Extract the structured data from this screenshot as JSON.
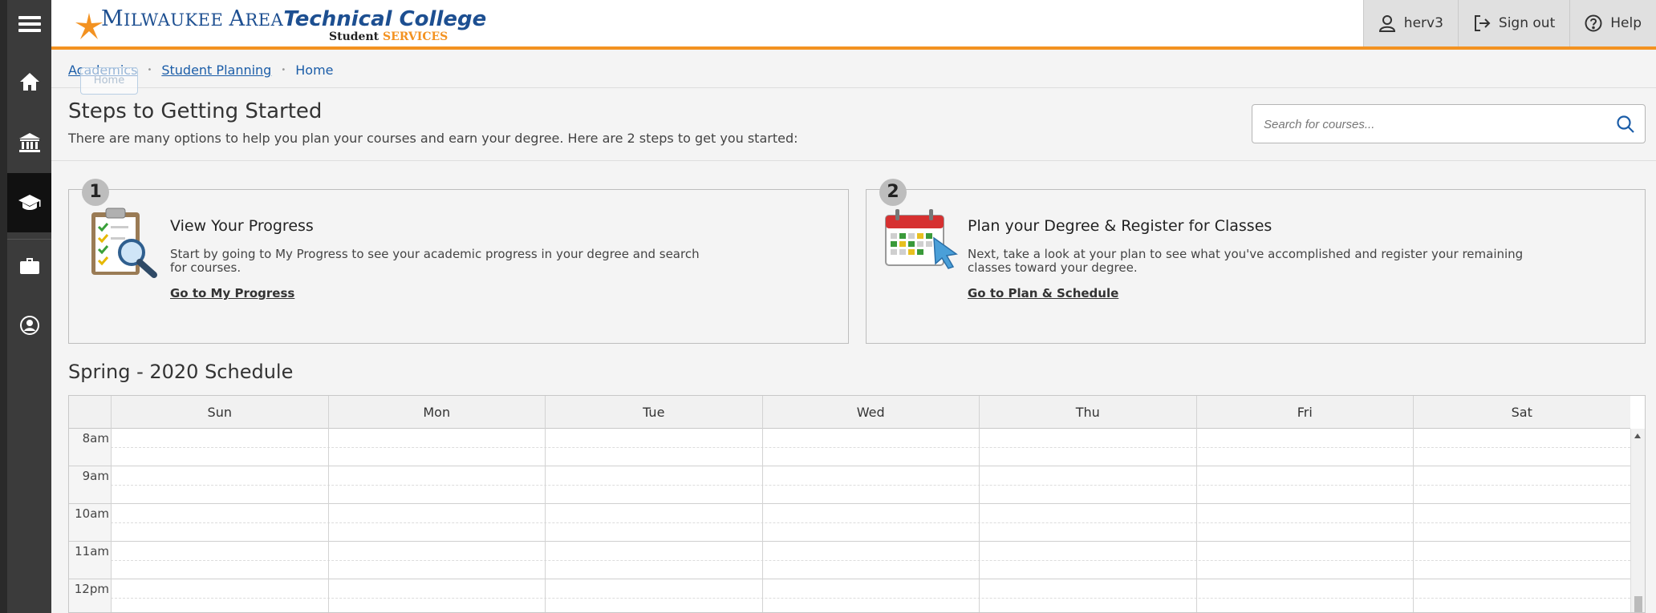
{
  "header": {
    "logo_name_prefix": "M",
    "logo_name_mid": "ILWAUKEE ",
    "logo_area_prefix": "A",
    "logo_area_mid": "REA",
    "logo_tech": "Technical College",
    "logo_sub_1": "Student ",
    "logo_sub_2": "SERVICES",
    "user": "herv3",
    "sign_out": "Sign out",
    "help": "Help"
  },
  "rail": {
    "items": [
      "menu",
      "home",
      "academics",
      "student-planning",
      "financial",
      "profile"
    ],
    "active": "student-planning"
  },
  "breadcrumb": {
    "items": [
      "Academics",
      "Student Planning"
    ],
    "current": "Home",
    "tooltip": "Home"
  },
  "getting_started": {
    "title": "Steps to Getting Started",
    "description": "There are many options to help you plan your courses and earn your degree. Here are 2 steps to get you started:",
    "search_placeholder": "Search for courses..."
  },
  "steps": [
    {
      "number": "1",
      "title": "View Your Progress",
      "text": "Start by going to My Progress to see your academic progress in your degree and search for courses.",
      "link": "Go to My Progress"
    },
    {
      "number": "2",
      "title": "Plan your Degree & Register for Classes",
      "text": "Next, take a look at your plan to see what you've accomplished and register your remaining classes toward your degree.",
      "link": "Go to Plan & Schedule"
    }
  ],
  "schedule": {
    "title": "Spring - 2020 Schedule",
    "days": [
      "Sun",
      "Mon",
      "Tue",
      "Wed",
      "Thu",
      "Fri",
      "Sat"
    ],
    "hours": [
      "8am",
      "9am",
      "10am",
      "11am",
      "12pm"
    ]
  },
  "colors": {
    "accent_orange": "#f39221",
    "brand_blue": "#1d4f91",
    "link_blue": "#1b5da8",
    "rail": "#3b3b3b"
  }
}
